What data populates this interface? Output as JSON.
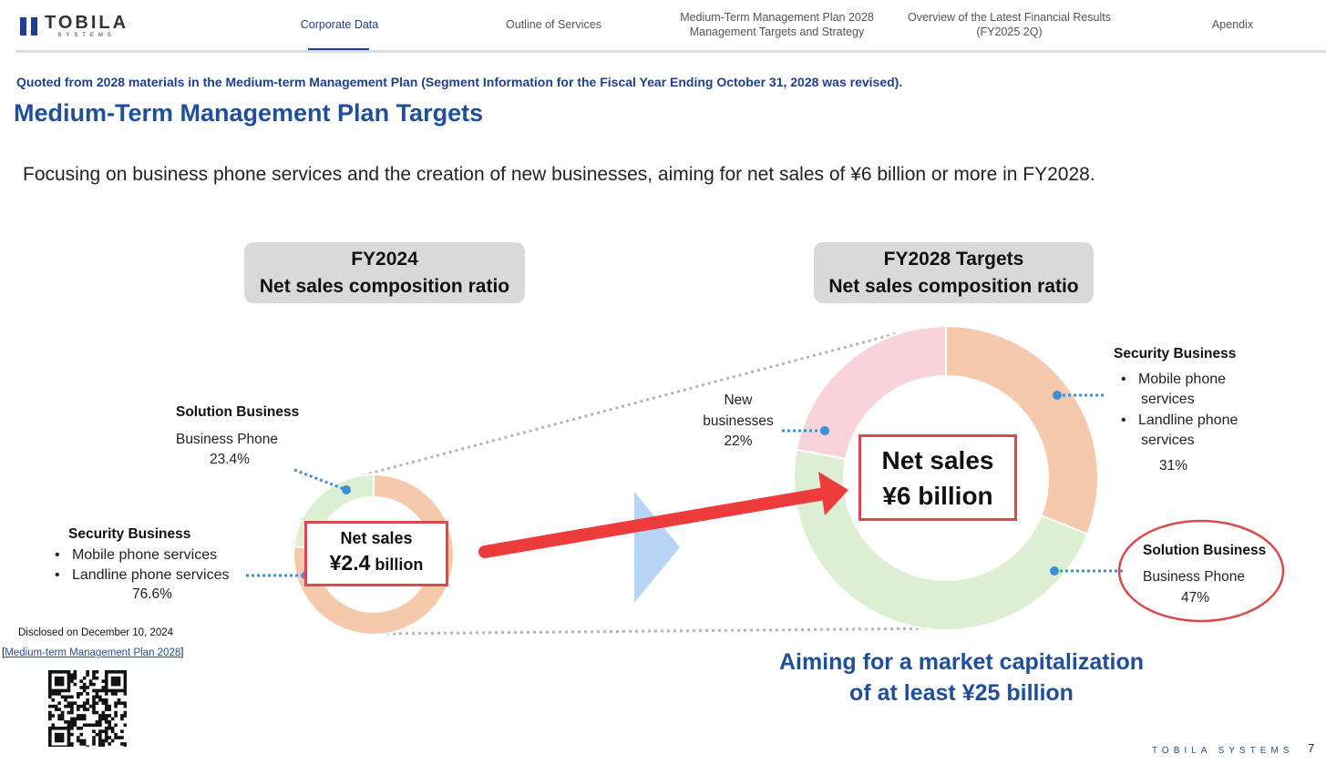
{
  "header": {
    "logo": "TOBILA",
    "logo_sub": "SYSTEMS",
    "nav": [
      {
        "label": "Corporate Data",
        "active": true
      },
      {
        "label": "Outline of Services",
        "active": false
      },
      {
        "label": "Medium-Term Management Plan 2028\nManagement Targets and Strategy",
        "active": false
      },
      {
        "label": "Overview of the Latest Financial Results\n(FY2025 2Q)",
        "active": false
      },
      {
        "label": "Apendix",
        "active": false
      }
    ]
  },
  "quoted_note": "Quoted from 2028 materials in the Medium-term Management Plan (Segment Information for the Fiscal Year Ending October 31, 2028 was revised).",
  "title": "Medium-Term Management Plan Targets",
  "subtitle": "Focusing on business phone services and the creation of new businesses, aiming for net sales of ¥6 billion or more in FY2028.",
  "left_chart": {
    "header_line1": "FY2024",
    "header_line2": "Net sales composition ratio",
    "center_line1": "Net sales",
    "center_value": "¥2.4",
    "center_unit": " billion",
    "solution": {
      "title": "Solution Business",
      "item": "Business Phone",
      "pct": "23.4%"
    },
    "security": {
      "title": "Security Business",
      "items": [
        "Mobile phone services",
        "Landline phone services"
      ],
      "pct": "76.6%"
    }
  },
  "right_chart": {
    "header_line1": "FY2028 Targets",
    "header_line2": "Net sales composition ratio",
    "center_line1": "Net sales",
    "center_line2": "¥6 billion",
    "new_biz": {
      "line1": "New",
      "line2": "businesses",
      "pct": "22%"
    },
    "security": {
      "title": "Security Business",
      "items": [
        "Mobile phone",
        "services",
        "Landline phone",
        "services"
      ],
      "pct": "31%"
    },
    "solution": {
      "title": "Solution Business",
      "item": "Business Phone",
      "pct": "47%"
    }
  },
  "chart_data": [
    {
      "type": "pie",
      "title": "FY2024 Net sales composition ratio",
      "categories": [
        "Security Business",
        "Solution Business"
      ],
      "values": [
        76.6,
        23.4
      ],
      "colors": [
        "#f6c9ad",
        "#dcefd3"
      ]
    },
    {
      "type": "pie",
      "title": "FY2028 Targets Net sales composition ratio",
      "categories": [
        "Security Business",
        "Solution Business",
        "New businesses"
      ],
      "values": [
        31,
        47,
        22
      ],
      "colors": [
        "#f6c9ad",
        "#dcefd3",
        "#f8d3da"
      ]
    }
  ],
  "market_cap_line1": "Aiming for a market capitalization",
  "market_cap_line2": "of at least ¥25 billion",
  "disclosed": "Disclosed on December 10, 2024",
  "plan_link": "Medium-term Management Plan 2028",
  "footer_brand": "TOBILA SYSTEMS",
  "page_number": "7",
  "colors": {
    "brand_blue": "#1f3f8e",
    "title_blue": "#1f4e9a",
    "highlight_red": "#d94a4a",
    "dot_blue": "#3b8fd4"
  }
}
